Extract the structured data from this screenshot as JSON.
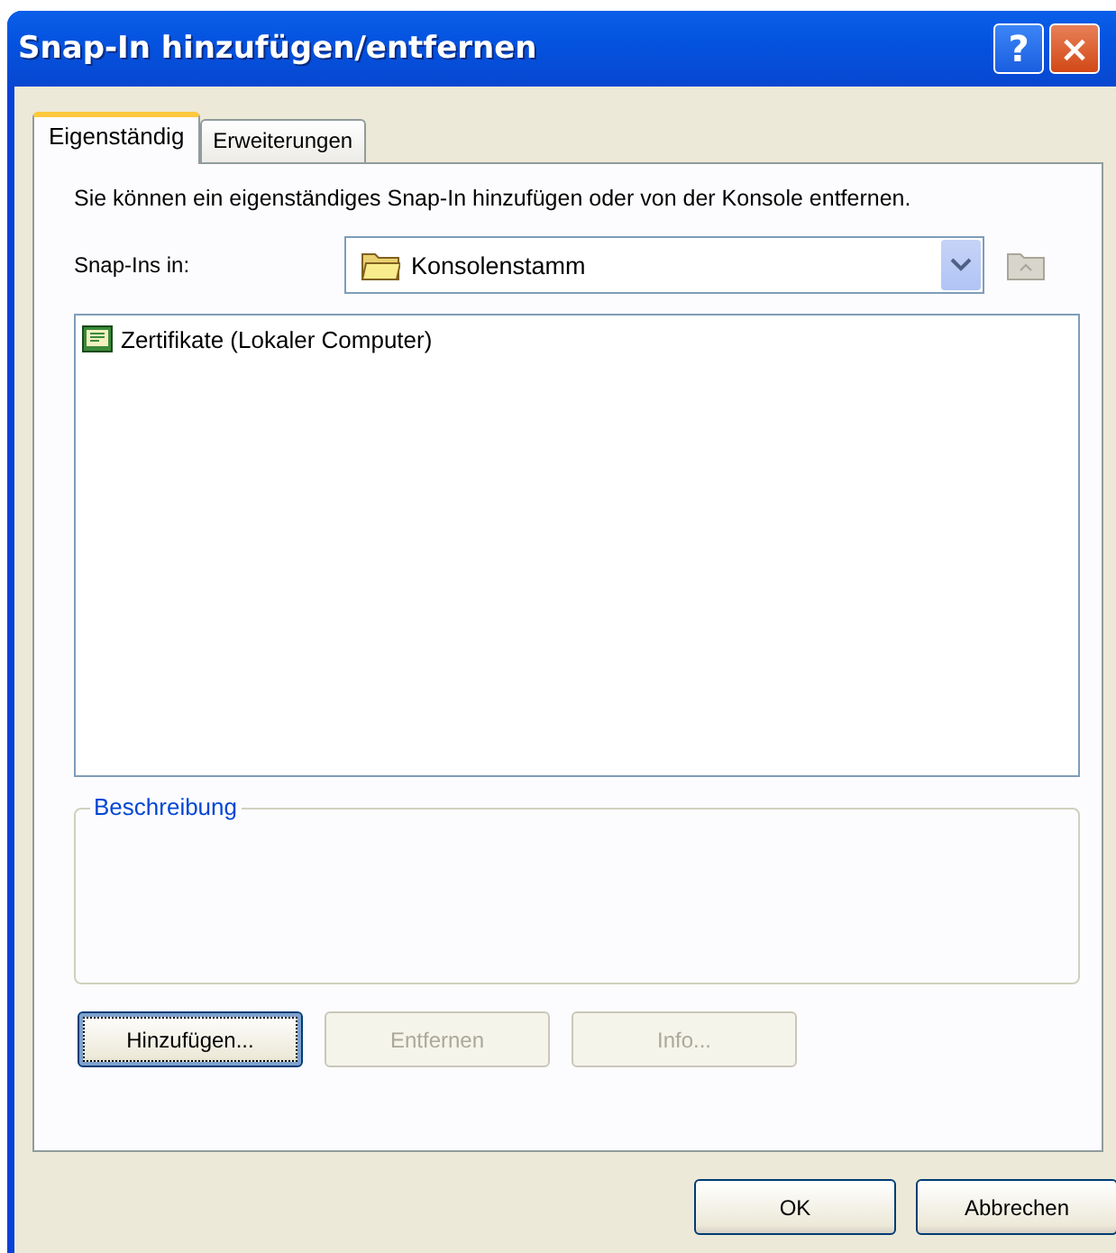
{
  "window": {
    "title": "Snap-In hinzufügen/entfernen",
    "help_button": "?",
    "close_button": "×"
  },
  "tabs": [
    {
      "label": "Eigenständig",
      "selected": true
    },
    {
      "label": "Erweiterungen",
      "selected": false
    }
  ],
  "description_text": "Sie können ein eigenständiges Snap-In hinzufügen oder von der Konsole entfernen.",
  "snapins_in": {
    "label": "Snap-Ins in:",
    "value": "Konsolenstamm"
  },
  "snapin_list": [
    {
      "label": "Zertifikate (Lokaler Computer)",
      "selected": false
    }
  ],
  "description_group": {
    "title": "Beschreibung"
  },
  "panel_buttons": [
    {
      "label": "Hinzufügen...",
      "disabled": false,
      "focused": true
    },
    {
      "label": "Entfernen",
      "disabled": true,
      "focused": false
    },
    {
      "label": "Info...",
      "disabled": true,
      "focused": false
    }
  ],
  "dialog_buttons": [
    {
      "label": "OK"
    },
    {
      "label": "Abbrechen"
    }
  ]
}
